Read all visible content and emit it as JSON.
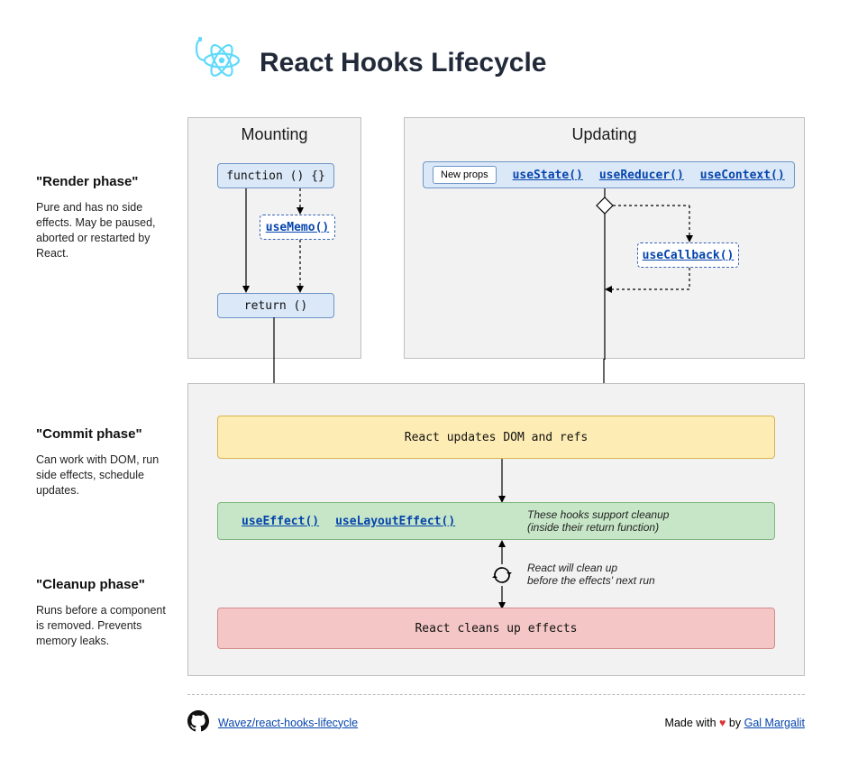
{
  "header": {
    "title": "React Hooks Lifecycle"
  },
  "phases": {
    "render": {
      "title": "\"Render phase\"",
      "desc": "Pure and has no side effects. May be paused, aborted or restarted by React."
    },
    "commit": {
      "title": "\"Commit phase\"",
      "desc": "Can work with DOM, run side effects, schedule updates."
    },
    "cleanup": {
      "title": "\"Cleanup phase\"",
      "desc": "Runs before a component is removed. Prevents memory leaks."
    }
  },
  "panels": {
    "mounting": "Mounting",
    "updating": "Updating"
  },
  "mounting": {
    "fn": "function () {}",
    "useMemo": "useMemo()",
    "ret": "return ()"
  },
  "updating": {
    "newProps": "New props",
    "useState": "useState()",
    "useReducer": "useReducer()",
    "useContext": "useContext()",
    "useCallback": "useCallback()"
  },
  "lower": {
    "updateDom": "React updates DOM and refs",
    "useEffect": "useEffect()",
    "useLayoutEffect": "useLayoutEffect()",
    "effectsNote1": "These hooks support cleanup",
    "effectsNote2": "(inside their return function)",
    "cycleNote1": "React will clean up",
    "cycleNote2": "before the effects' next run",
    "cleans": "React cleans up effects"
  },
  "footer": {
    "repo": "Wavez/react-hooks-lifecycle",
    "madeWith": "Made with",
    "by": "by",
    "author": "Gal Margalit"
  }
}
